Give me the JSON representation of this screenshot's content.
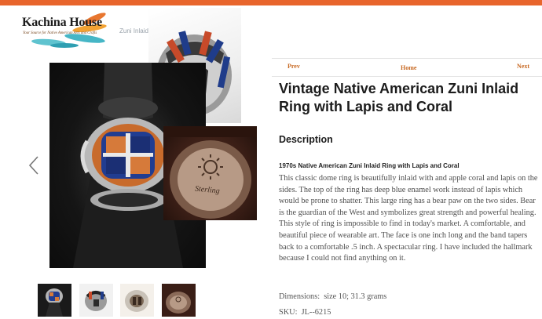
{
  "header": {
    "logo_title": "Kachina House",
    "logo_tagline": "Your Source for Native American Arts and Crafts",
    "breadcrumb_fragment": "Zuni Inlaid",
    "accent_color": "#e8652c"
  },
  "gallery": {
    "main_image": "ring-on-display-stand",
    "side_image": "ring-side-view-bear-paw",
    "hallmark_image": "ring-inner-band-sterling-hallmark",
    "hallmark_text": "Sterling",
    "prev_arrow_icon": "chevron-left-icon",
    "thumbnails": [
      "thumbnail-front",
      "thumbnail-side",
      "thumbnail-top",
      "thumbnail-hallmark"
    ]
  },
  "nav": {
    "prev": "Prev",
    "home": "Home",
    "next": "Next"
  },
  "product": {
    "title": "Vintage Native American Zuni Inlaid Ring with Lapis and Coral",
    "description_heading": "Description",
    "subheading": "1970s Native American Zuni Inlaid Ring with Lapis and Coral",
    "body": "This classic dome ring is beautifully inlaid with and apple coral and lapis on the sides. The top of the ring has deep blue enamel work instead of lapis which would be prone to shatter. This large ring has a bear paw on the two sides. Bear is the guardian of the West and symbolizes great strength and powerful healing. This style of ring is impossible to find in today's market. A comfortable, and beautiful piece of wearable art. The face is one inch long and the band tapers back to a comfortable .5 inch. A spectacular ring. I have included the hallmark because I could not find anything on it.",
    "dimensions_label": "Dimensions:",
    "dimensions_value": "size 10; 31.3 grams",
    "sku_label": "SKU:",
    "sku_value": "JL--6215"
  }
}
